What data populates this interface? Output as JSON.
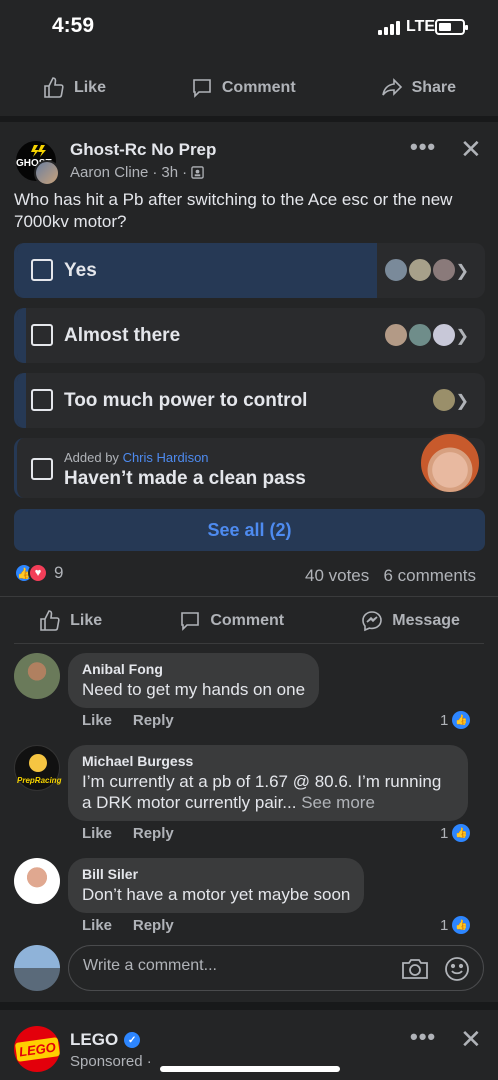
{
  "status_bar": {
    "time": "4:59",
    "network": "LTE"
  },
  "top_actions": {
    "like": "Like",
    "comment": "Comment",
    "share": "Share"
  },
  "post": {
    "group_name": "Ghost-Rc No Prep",
    "group_logo_text": "GHOST",
    "author": "Aaron Cline",
    "time": "3h",
    "question": "Who has hit a Pb after switching to the Ace esc or the new 7000kv motor?",
    "poll": {
      "options": [
        {
          "label": "Yes",
          "fill_percent": 77
        },
        {
          "label": "Almost there",
          "fill_percent": 2
        },
        {
          "label": "Too much power to control",
          "fill_percent": 2
        },
        {
          "label": "Haven’t made a clean pass",
          "added_by_prefix": "Added by",
          "added_by": "Chris Hardison",
          "fill_percent": 0
        }
      ],
      "see_all": "See all (2)"
    },
    "reaction_count": "9",
    "votes": "40 votes",
    "comments_count": "6 comments",
    "actions": {
      "like": "Like",
      "comment": "Comment",
      "message": "Message"
    }
  },
  "comments": [
    {
      "name": "Anibal Fong",
      "text": "Need to get my hands on one",
      "more": "",
      "like": "Like",
      "reply": "Reply",
      "likes": "1"
    },
    {
      "name": "Michael Burgess",
      "text": "I’m currently at a pb of 1.67 @ 80.6. I’m running a DRK motor currently pair...",
      "more": "See more",
      "like": "Like",
      "reply": "Reply",
      "likes": "1",
      "avatar_text": "PrepRacing"
    },
    {
      "name": "Bill Siler",
      "text": "Don’t have a motor yet maybe soon",
      "more": "",
      "like": "Like",
      "reply": "Reply",
      "likes": "1"
    }
  ],
  "comment_input": {
    "placeholder": "Write a comment..."
  },
  "next_post": {
    "name": "LEGO",
    "logo_text": "LEGO",
    "sponsored": "Sponsored ·"
  },
  "colors": {
    "accent": "#2d86ff",
    "poll_fill": "#263955",
    "background": "#18191a",
    "card": "#242526"
  }
}
